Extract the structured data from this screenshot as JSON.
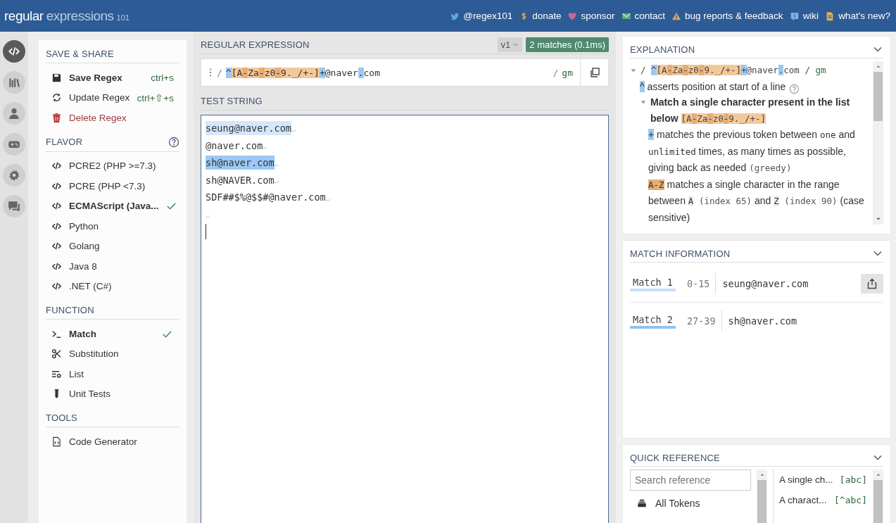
{
  "header": {
    "logo": {
      "main": "regular",
      "sub": "expressions",
      "version": "101"
    },
    "links": [
      {
        "kind": "bird",
        "label": "@regex101"
      },
      {
        "kind": "dollar",
        "label": "donate"
      },
      {
        "kind": "heart",
        "label": "sponsor"
      },
      {
        "kind": "envelope",
        "label": "contact"
      },
      {
        "kind": "warning",
        "label": "bug reports & feedback"
      },
      {
        "kind": "wiki",
        "label": "wiki"
      },
      {
        "kind": "news",
        "label": "what's new?"
      }
    ]
  },
  "rail": [
    {
      "kind": "code",
      "selected": true
    },
    {
      "kind": "library",
      "selected": false
    },
    {
      "kind": "user",
      "selected": false
    },
    {
      "kind": "gamepad",
      "selected": false
    },
    {
      "kind": "gear",
      "selected": false
    },
    {
      "kind": "chat",
      "selected": false
    }
  ],
  "sidebar": {
    "sections": [
      {
        "title": "SAVE & SHARE",
        "items": [
          {
            "kind": "save",
            "label": "Save Regex",
            "shortcut": "ctrl+s"
          },
          {
            "kind": "refresh",
            "label": "Update Regex",
            "shortcut": "ctrl+⇧+s"
          },
          {
            "kind": "trash",
            "label": "Delete Regex"
          }
        ]
      },
      {
        "title": "FLAVOR",
        "help": true,
        "items": [
          {
            "kind": "code",
            "label": "PCRE2 (PHP >=7.3)",
            "selected": false
          },
          {
            "kind": "code",
            "label": "PCRE (PHP <7.3)",
            "selected": false
          },
          {
            "kind": "code",
            "label": "ECMAScript (Java...",
            "selected": true
          },
          {
            "kind": "code",
            "label": "Python",
            "selected": false
          },
          {
            "kind": "code",
            "label": "Golang",
            "selected": false
          },
          {
            "kind": "code",
            "label": "Java 8",
            "selected": false
          },
          {
            "kind": "code",
            "label": ".NET (C#)",
            "selected": false
          }
        ]
      },
      {
        "title": "FUNCTION",
        "items": [
          {
            "kind": "prompt",
            "label": "Match",
            "selected": true
          },
          {
            "kind": "scissors",
            "label": "Substitution",
            "selected": false
          },
          {
            "kind": "list",
            "label": "List",
            "selected": false
          },
          {
            "kind": "tube",
            "label": "Unit Tests",
            "selected": false
          }
        ]
      },
      {
        "title": "TOOLS",
        "items": [
          {
            "kind": "file-code",
            "label": "Code Generator"
          }
        ]
      }
    ]
  },
  "regex": {
    "title": "REGULAR EXPRESSION",
    "version": "v1",
    "status": "2 matches (0.1ms)",
    "delimiter": "/",
    "flags_delimiter": "/",
    "flags": "gm",
    "tokens": [
      {
        "kind": "anchor",
        "text": "^"
      },
      {
        "kind": "class",
        "text": "[A"
      },
      {
        "kind": "range",
        "text": "-"
      },
      {
        "kind": "class",
        "text": "Za"
      },
      {
        "kind": "range",
        "text": "-"
      },
      {
        "kind": "class",
        "text": "z0"
      },
      {
        "kind": "range",
        "text": "-"
      },
      {
        "kind": "class",
        "text": "9._/+-]"
      },
      {
        "kind": "anchor",
        "text": "+"
      },
      {
        "kind": "plain",
        "text": "@naver"
      },
      {
        "kind": "anchor",
        "text": "."
      },
      {
        "kind": "plain",
        "text": "com"
      }
    ]
  },
  "test_string": {
    "title": "TEST STRING",
    "lines": [
      {
        "text": "seung@naver.com",
        "color": "#d4e7fb",
        "end": "↵"
      },
      {
        "text": "@naver.com",
        "end": "↵"
      },
      {
        "text": "sh@naver.com",
        "color": "#9bc8f4",
        "end": "↵"
      },
      {
        "text": "sh@NAVER.com",
        "end": "↵"
      },
      {
        "text": "SDF##$%@$$#@naver.com",
        "end": "↵"
      },
      {
        "end": "↵"
      }
    ]
  },
  "explanation": {
    "title": "EXPLANATION",
    "tree": [
      {
        "expanded": true,
        "segments": [
          {
            "kind": "text",
            "text": "/ "
          },
          {
            "kind": "anchor",
            "text": "^"
          },
          {
            "kind": "class",
            "text": "[A"
          },
          {
            "kind": "range",
            "text": "-"
          },
          {
            "kind": "class",
            "text": "Za"
          },
          {
            "kind": "range",
            "text": "-"
          },
          {
            "kind": "class",
            "text": "z0"
          },
          {
            "kind": "range",
            "text": "-"
          },
          {
            "kind": "class",
            "text": "9._/+-]"
          },
          {
            "kind": "anchor",
            "text": "+"
          },
          {
            "kind": "plain",
            "text": "@naver"
          },
          {
            "kind": "anchor",
            "text": "."
          },
          {
            "kind": "plain",
            "text": "com / "
          },
          {
            "kind": "flags",
            "text": "gm"
          }
        ],
        "children": [
          {
            "help": true,
            "segments": [
              {
                "kind": "anchor",
                "text": "^"
              },
              {
                "kind": "text",
                "text": " asserts position at start of a line"
              }
            ]
          },
          {
            "expanded": true,
            "segments": [
              {
                "kind": "bold",
                "text": "Match a single character present in the list below "
              },
              {
                "kind": "class",
                "text": "[A"
              },
              {
                "kind": "range",
                "text": "-"
              },
              {
                "kind": "class",
                "text": "Za"
              },
              {
                "kind": "range",
                "text": "-"
              },
              {
                "kind": "class",
                "text": "z0"
              },
              {
                "kind": "range",
                "text": "-"
              },
              {
                "kind": "class",
                "text": "9._/+-]"
              }
            ],
            "children": [
              {
                "segments": [
                  {
                    "kind": "anchor",
                    "text": "+"
                  },
                  {
                    "kind": "text",
                    "text": " matches the previous token between "
                  },
                  {
                    "kind": "code",
                    "text": "one"
                  },
                  {
                    "kind": "text",
                    "text": " and "
                  },
                  {
                    "kind": "code",
                    "text": "unlimited"
                  },
                  {
                    "kind": "text",
                    "text": " times, as many times as possible, giving back as needed "
                  },
                  {
                    "kind": "muted",
                    "text": "(greedy)"
                  }
                ]
              },
              {
                "segments": [
                  {
                    "kind": "rangebox",
                    "text": "A-Z"
                  },
                  {
                    "kind": "text",
                    "text": " matches a single character in the range between "
                  },
                  {
                    "kind": "char",
                    "text": "A"
                  },
                  {
                    "kind": "muted",
                    "text": " (index 65)"
                  },
                  {
                    "kind": "text",
                    "text": " and "
                  },
                  {
                    "kind": "char",
                    "text": "Z"
                  },
                  {
                    "kind": "muted",
                    "text": " (index 90)"
                  },
                  {
                    "kind": "text",
                    "text": " (case sensitive)"
                  }
                ]
              }
            ]
          }
        ]
      }
    ]
  },
  "match_information": {
    "title": "MATCH INFORMATION",
    "matches": [
      {
        "label": "Match 1",
        "range": "0-15",
        "value": "seung@naver.com",
        "color": "#c8e0fa"
      },
      {
        "label": "Match 2",
        "range": "27-39",
        "value": "sh@naver.com",
        "color": "#90c2f3"
      }
    ]
  },
  "quick_reference": {
    "title": "QUICK REFERENCE",
    "search": {
      "placeholder": "Search reference"
    },
    "categories": [
      {
        "kind": "stack",
        "label": "All Tokens"
      }
    ],
    "tokens": [
      {
        "description": "A single ch...",
        "code": "[abc]"
      },
      {
        "description": "A charact...",
        "code": "[^abc]"
      }
    ]
  }
}
